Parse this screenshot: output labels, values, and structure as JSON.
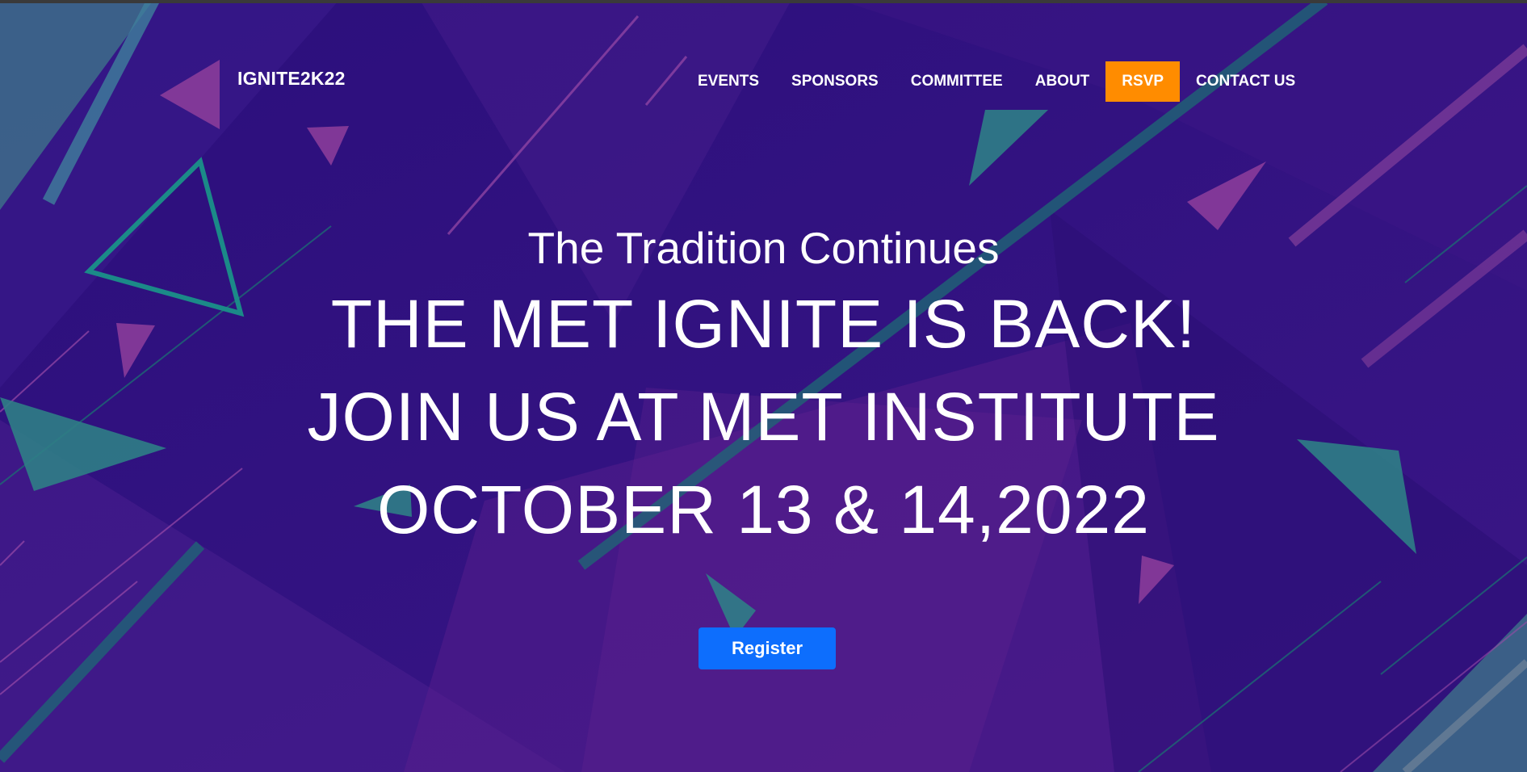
{
  "brand": "IGNITE2K22",
  "nav": {
    "items": [
      {
        "label": "EVENTS"
      },
      {
        "label": "SPONSORS"
      },
      {
        "label": "COMMITTEE"
      },
      {
        "label": "ABOUT"
      },
      {
        "label": "RSVP",
        "highlight_color": "#ff8c00"
      },
      {
        "label": "CONTACT US"
      }
    ]
  },
  "hero": {
    "tagline": "The Tradition Continues",
    "lines": [
      "THE MET IGNITE IS BACK!",
      "JOIN US AT MET INSTITUTE",
      "OCTOBER 13 & 14,2022"
    ]
  },
  "cta": {
    "register_label": "Register",
    "color": "#0d6efd"
  },
  "theme": {
    "background": "#2a0f7a",
    "accent_purple": "#6a2a8f",
    "accent_teal": "#2f8a8a"
  }
}
